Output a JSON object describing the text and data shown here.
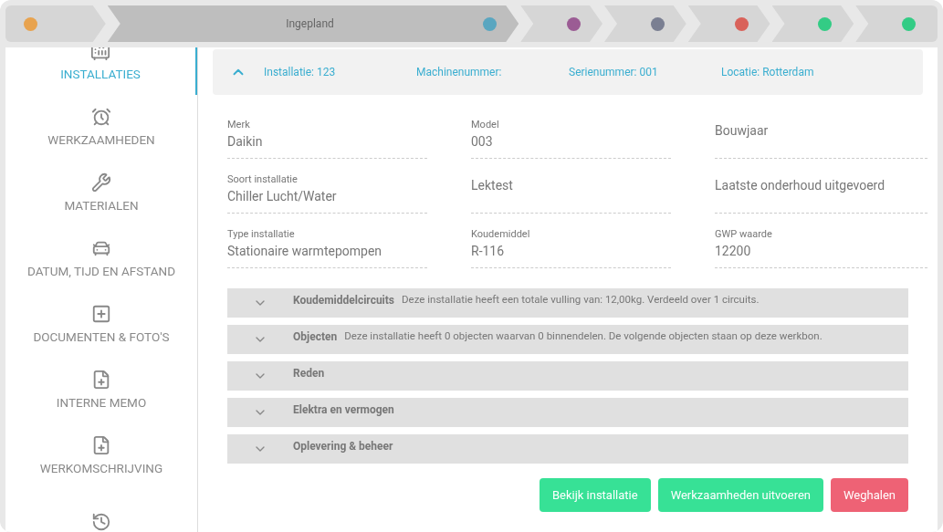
{
  "status_steps": [
    {
      "color": "#e8a34f",
      "selected": false
    },
    {
      "label": "Ingepland",
      "color": "#5aa6c0",
      "selected": true
    },
    {
      "color": "#9b5c94",
      "selected": false
    },
    {
      "color": "#7a7f92",
      "selected": false
    },
    {
      "color": "#d9625a",
      "selected": false
    },
    {
      "color": "#33cc85",
      "selected": false
    },
    {
      "color": "#33cc85",
      "selected": false
    }
  ],
  "sidebar": {
    "items": [
      {
        "label": "INSTALLATIES",
        "selected": true
      },
      {
        "label": "WERKZAAMHEDEN",
        "selected": false
      },
      {
        "label": "MATERIALEN",
        "selected": false
      },
      {
        "label": "DATUM, TIJD EN AFSTAND",
        "selected": false
      },
      {
        "label": "DOCUMENTEN & FOTO'S",
        "selected": false
      },
      {
        "label": "INTERNE MEMO",
        "selected": false
      },
      {
        "label": "WERKOMSCHRIJVING",
        "selected": false
      },
      {
        "selected": false
      }
    ]
  },
  "installation": {
    "expanded": true,
    "summary": [
      "Installatie: 123",
      "Machinenummer:",
      "Serienummer: 001",
      "Locatie: Rotterdam"
    ],
    "fields": [
      {
        "label": "Merk",
        "value": "Daikin"
      },
      {
        "label": "Model",
        "value": "003"
      },
      {
        "value": "Bouwjaar"
      },
      {
        "label": "Soort installatie",
        "value": "Chiller Lucht/Water"
      },
      {
        "value": "Lektest"
      },
      {
        "value": "Laatste onderhoud uitgevoerd"
      },
      {
        "label": "Type installatie",
        "value": "Stationaire warmtepompen"
      },
      {
        "label": "Koudemiddel",
        "value": "R-116"
      },
      {
        "label": "GWP waarde",
        "value": "12200"
      }
    ]
  },
  "sections": [
    {
      "title": "Koudemiddelcircuits",
      "description": "Deze installatie heeft een totale vulling van: 12,00kg. Verdeeld over 1 circuits.",
      "expanded": false
    },
    {
      "title": "Objecten",
      "description": "Deze installatie heeft 0 objecten waarvan 0 binnendelen. De volgende objecten staan op deze werkbon.",
      "expanded": false
    },
    {
      "title": "Reden",
      "expanded": false
    },
    {
      "title": "Elektra en vermogen",
      "expanded": false
    },
    {
      "title": "Oplevering & beheer",
      "expanded": false
    }
  ],
  "buttons": [
    {
      "label": "Bekijk installatie",
      "kind": "primary"
    },
    {
      "label": "Werkzaamheden uitvoeren",
      "kind": "primary"
    },
    {
      "label": "Weghalen",
      "kind": "danger"
    }
  ]
}
